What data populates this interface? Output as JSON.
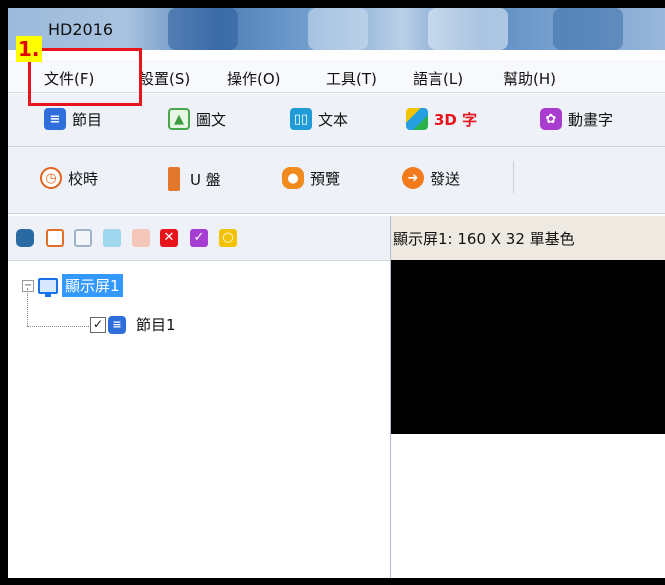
{
  "annotation": {
    "step": "1."
  },
  "titlebar": {
    "app_title": "HD2016"
  },
  "menu": [
    "文件(F)",
    "設置(S)",
    "操作(O)",
    "工具(T)",
    "語言(L)",
    "幫助(H)"
  ],
  "toolbar1": [
    {
      "label": "節目",
      "icon": "program-icon"
    },
    {
      "label": "圖文",
      "icon": "image-text-icon"
    },
    {
      "label": "文本",
      "icon": "book-icon"
    },
    {
      "label": "3D 字",
      "icon": "3d-cube-icon"
    },
    {
      "label": "動畫字",
      "icon": "animated-text-icon"
    }
  ],
  "toolbar2": [
    {
      "label": "校時",
      "icon": "clock-sync-icon"
    },
    {
      "label": "U 盤",
      "icon": "usb-drive-icon"
    },
    {
      "label": "預覽",
      "icon": "camera-icon"
    },
    {
      "label": "發送",
      "icon": "send-arrow-icon"
    }
  ],
  "tree": {
    "screen_label": "顯示屏1",
    "program_label": "節目1",
    "program_checked": true
  },
  "preview": {
    "header": "顯示屏1: 160 X 32  單基色"
  },
  "colors": {
    "red": "#e8141c",
    "blue": "#1a73e8",
    "badge_yellow": "#ffff00",
    "3d_text": "#e8141c"
  }
}
